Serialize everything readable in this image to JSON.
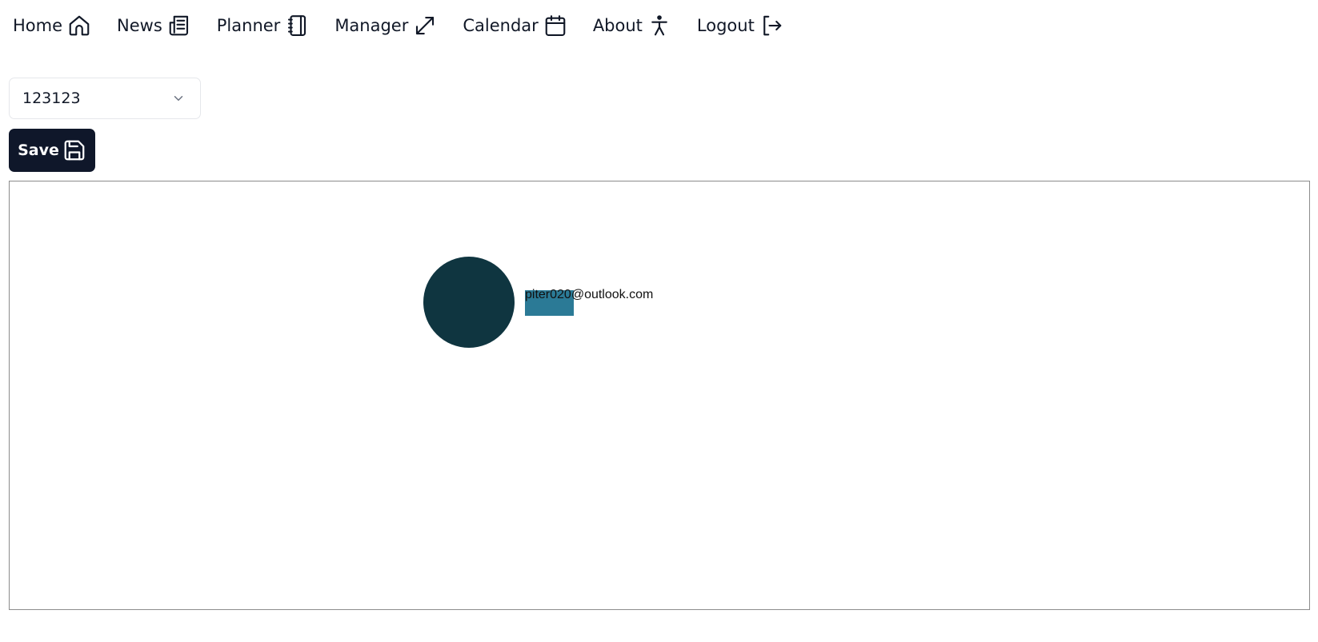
{
  "nav": {
    "items": [
      {
        "label": "Home",
        "icon": "home-icon"
      },
      {
        "label": "News",
        "icon": "newspaper-icon"
      },
      {
        "label": "Planner",
        "icon": "notebook-icon"
      },
      {
        "label": "Manager",
        "icon": "expand-arrows-icon"
      },
      {
        "label": "Calendar",
        "icon": "calendar-icon"
      },
      {
        "label": "About",
        "icon": "accessibility-icon"
      },
      {
        "label": "Logout",
        "icon": "logout-icon"
      }
    ]
  },
  "selector": {
    "value": "123123",
    "icon": "chevron-down-icon"
  },
  "toolbar": {
    "save_label": "Save",
    "save_icon": "save-icon"
  },
  "canvas": {
    "node": {
      "label": "piter020@outlook.com",
      "circle_color": "#0f3540",
      "highlight_color": "#2b7a96"
    }
  }
}
